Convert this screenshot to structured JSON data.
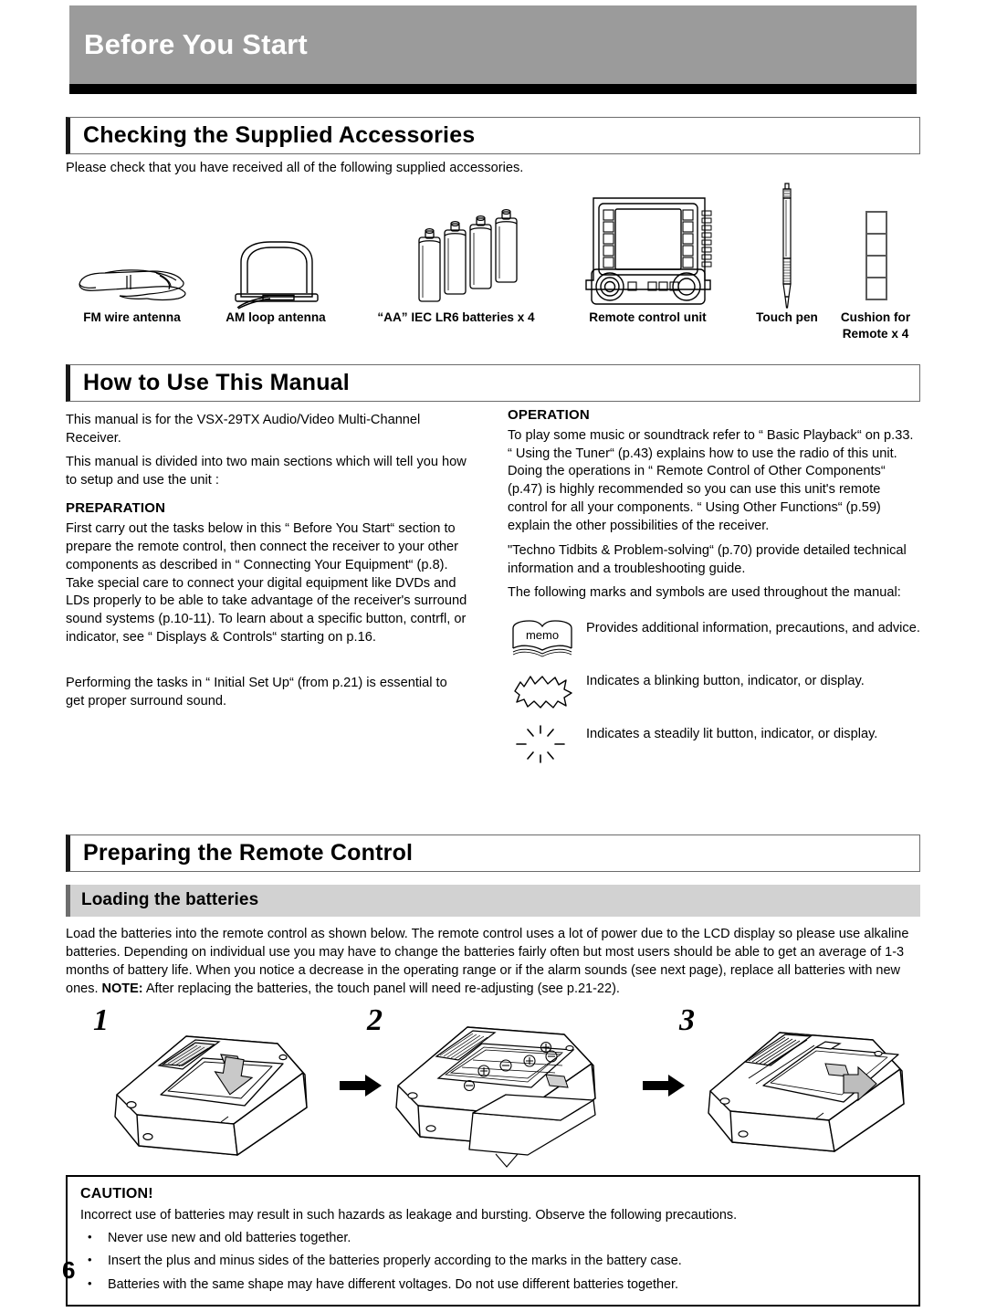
{
  "page": {
    "header_title": "Before You Start",
    "page_number": "6"
  },
  "accessories_section": {
    "title": "Checking the Supplied Accessories",
    "intro": "Please check that you have received all of the following supplied accessories.",
    "items": [
      {
        "label": "FM wire antenna",
        "icon": "fm-wire-antenna-icon"
      },
      {
        "label": "AM loop antenna",
        "icon": "am-loop-antenna-icon"
      },
      {
        "label": "“AA” IEC LR6 batteries x 4",
        "icon": "aa-batteries-icon"
      },
      {
        "label": "Remote control unit",
        "icon": "remote-control-unit-icon"
      },
      {
        "label": "Touch pen",
        "icon": "touch-pen-icon"
      },
      {
        "label_line1": "Cushion for",
        "label_line2": "Remote x 4",
        "icon": "cushion-icon"
      }
    ]
  },
  "manual_section": {
    "title": "How to Use This Manual",
    "left": {
      "para1": "This manual is for the VSX-29TX Audio/Video Multi-Channel Receiver.",
      "para2": "This manual is divided into two main sections which will tell you how to setup and use the unit :",
      "preparation_heading": "PREPARATION",
      "preparation_body": "First carry out the tasks below in this “ Before You Start“ section to prepare the remote control, then connect the receiver to your other components as described in “ Connecting Your Equipment“  (p.8). Take special care to connect your digital equipment like DVDs and LDs properly to be able to take advantage of the receiver's surround sound systems (p.10-11). To learn about a specific button, contrfl, or indicator, see “ Displays & Controls“  starting on p.16.",
      "closing": "Performing the tasks in “ Initial Set Up“  (from p.21) is essential to get proper surround sound."
    },
    "right": {
      "operation_heading": "OPERATION",
      "operation_body": "To play some music or soundtrack refer to “ Basic Playback“  on p.33. “ Using the Tuner“  (p.43) explains how to use the radio of this unit. Doing the operations in “ Remote Control of Other Components“  (p.47) is highly recommended so you can use this unit's remote control for all your components.  “ Using Other Functions“  (p.59) explain the other possibilities of the receiver.",
      "techno_body": "\"Techno Tidbits & Problem-solving“  (p.70) provide detailed technical information and a troubleshooting guide.",
      "marks_intro": "The following marks and symbols are used throughout the manual:",
      "legend": [
        {
          "icon": "memo-book-icon",
          "icon_text": "memo",
          "text": "Provides additional information, precautions, and advice."
        },
        {
          "icon": "blinking-burst-icon",
          "text": "Indicates a blinking button, indicator, or display."
        },
        {
          "icon": "steady-lit-icon",
          "text": "Indicates a steadily lit button, indicator, or display."
        }
      ]
    }
  },
  "remote_section": {
    "title": "Preparing the Remote Control",
    "subsection_title": "Loading the batteries",
    "body_part1": "Load the batteries into the remote control as shown below. The remote control uses a lot of power due to the LCD display so please use alkaline batteries. Depending on individual use you may have to change the batteries fairly often but most users should be able to get an average of 1-3 months of battery life. When you notice a decrease in the operating range or if the alarm sounds (see next page), replace all batteries with new ones. ",
    "body_note_label": "NOTE:",
    "body_part2": " After replacing the batteries, the touch panel will need re-adjusting (see p.21-22).",
    "steps": [
      {
        "number": "1",
        "icon": "remote-back-cover-open-icon"
      },
      {
        "number": "2",
        "icon": "remote-battery-compartment-icon"
      },
      {
        "number": "3",
        "icon": "remote-back-cover-close-icon"
      }
    ]
  },
  "caution": {
    "title": "CAUTION!",
    "lead": "Incorrect use of batteries may result in such hazards as leakage and bursting. Observe the following precautions.",
    "bullets": [
      "Never use new and old batteries together.",
      "Insert the plus and minus sides of the batteries properly according to the marks in the battery case.",
      "Batteries with the same shape may have different voltages. Do not use different batteries together."
    ]
  },
  "colors": {
    "header_gray": "#9b9b9b",
    "header_rule": "#000000",
    "subsection_gray": "#d2d2d2",
    "text": "#000000",
    "page_background": "#ffffff"
  }
}
